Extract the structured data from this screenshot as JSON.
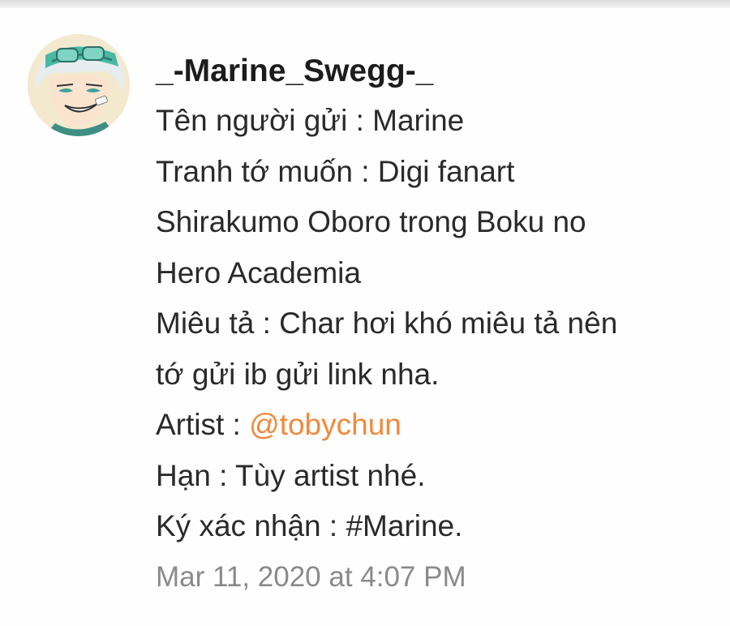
{
  "comment": {
    "username": "_-Marine_Swegg-_",
    "lines": [
      "Tên người gửi : Marine",
      "Tranh tớ muốn : Digi fanart",
      "Shirakumo Oboro trong Boku no",
      "Hero Academia",
      "Miêu tả : Char hơi khó miêu tả nên",
      "tớ gửi ib gửi link nha."
    ],
    "artist_prefix": "Artist : ",
    "artist_mention": "@tobychun",
    "deadline": "Hạn : Tùy artist nhé.",
    "confirm": "Ký xác nhận : #Marine.",
    "timestamp": "Mar 11, 2020 at 4:07 PM"
  },
  "colors": {
    "mention": "#f08a3c",
    "timestamp": "#8a8a8a",
    "text": "#2a2a2a"
  }
}
